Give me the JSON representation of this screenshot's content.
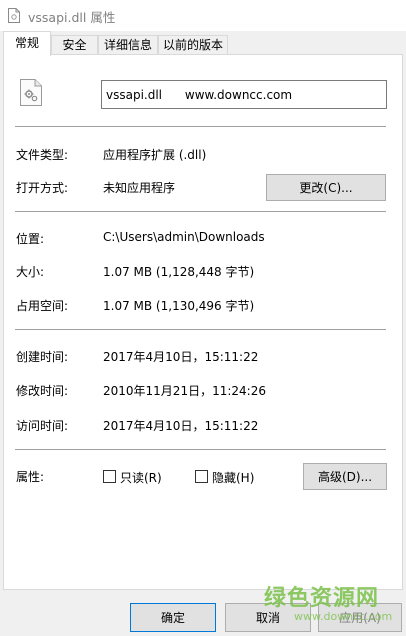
{
  "window": {
    "title": "vssapi.dll 属性"
  },
  "tabs": [
    {
      "label": "常规",
      "active": true
    },
    {
      "label": "安全",
      "active": false
    },
    {
      "label": "详细信息",
      "active": false
    },
    {
      "label": "以前的版本",
      "active": false
    }
  ],
  "general": {
    "file_name": "vssapi.dll      www.downcc.com",
    "rows": {
      "file_type": {
        "label": "文件类型:",
        "value": "应用程序扩展 (.dll)"
      },
      "opens_with": {
        "label": "打开方式:",
        "value": "未知应用程序",
        "button": "更改(C)..."
      },
      "location": {
        "label": "位置:",
        "value": "C:\\Users\\admin\\Downloads"
      },
      "size": {
        "label": "大小:",
        "value": "1.07 MB (1,128,448 字节)"
      },
      "size_on_disk": {
        "label": "占用空间:",
        "value": "1.07 MB (1,130,496 字节)"
      },
      "created": {
        "label": "创建时间:",
        "value": "2017年4月10日，15:11:22"
      },
      "modified": {
        "label": "修改时间:",
        "value": "2010年11月21日，11:24:26"
      },
      "accessed": {
        "label": "访问时间:",
        "value": "2017年4月10日，15:11:22"
      }
    },
    "attributes": {
      "label": "属性:",
      "readonly": {
        "label": "只读(R)",
        "checked": false
      },
      "hidden": {
        "label": "隐藏(H)",
        "checked": false
      },
      "advanced_button": "高级(D)..."
    }
  },
  "footer": {
    "ok": "确定",
    "cancel": "取消",
    "apply": "应用(A)"
  },
  "watermark": {
    "text": "绿色资源网",
    "url": "www.downcc.com"
  },
  "icons": {
    "app": "dll-file-icon",
    "file": "dll-gear-file-icon"
  }
}
